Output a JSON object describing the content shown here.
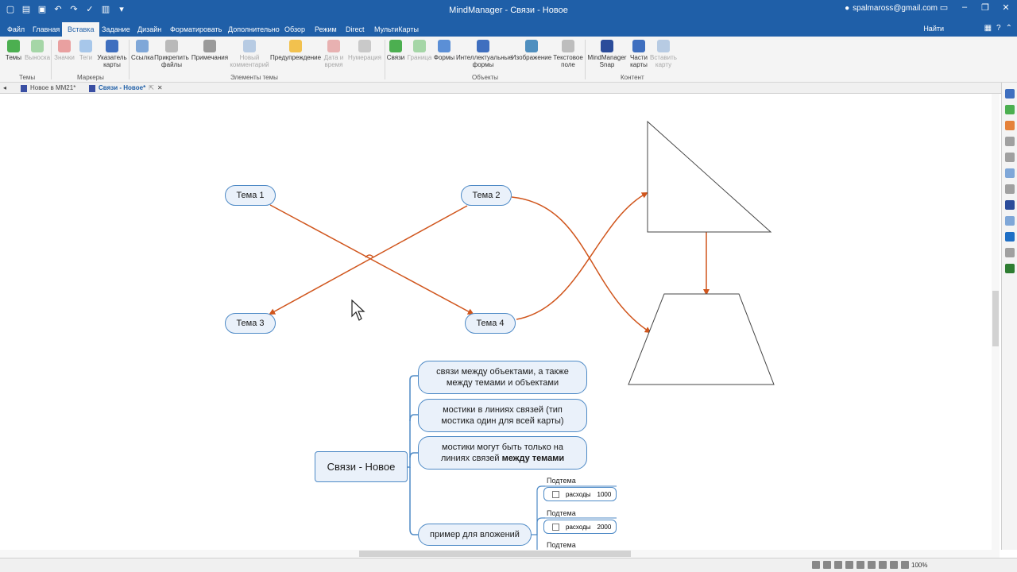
{
  "window": {
    "title": "MindManager - Связи - Новое",
    "account": "spalmaross@gmail.com"
  },
  "menu": {
    "tabs": [
      "Файл",
      "Главная",
      "Вставка",
      "Задание",
      "Дизайн",
      "Форматировать",
      "Дополнительно",
      "Обзор",
      "Режим",
      "Direct",
      "МультиКарты"
    ],
    "active": "Вставка",
    "search": "Найти"
  },
  "ribbon": {
    "buttons": {
      "topics": "Темы",
      "callout": "Выноска",
      "icons": "Значки",
      "tags": "Теги",
      "map_index": "Указатель карты",
      "link": "Ссылка",
      "attach": "Прикрепить файлы",
      "notes": "Примечания",
      "new_comment": "Новый комментарий",
      "alert": "Предупреждение",
      "date_time": "Дата и время",
      "numbering": "Нумерация",
      "relations": "Связи",
      "boundary": "Граница",
      "shapes": "Формы",
      "smart_shapes": "Интеллектуальные формы",
      "image": "Изображение",
      "text_box": "Текстовое поле",
      "snap": "MindManager Snap",
      "map_parts": "Части карты",
      "insert_map": "Вставить карту"
    },
    "groups": {
      "topics": "Темы",
      "markers": "Маркеры",
      "topic_elements": "Элементы темы",
      "objects": "Объекты",
      "content": "Контент"
    }
  },
  "doc_tabs": [
    {
      "label": "Новое в MM21*",
      "active": false
    },
    {
      "label": "Связи - Новое*",
      "active": true
    }
  ],
  "map": {
    "topics": {
      "t1": "Тема 1",
      "t2": "Тема 2",
      "t3": "Тема 3",
      "t4": "Тема 4"
    },
    "central": "Связи - Новое",
    "branches": {
      "b1": "связи между объектами, а также между темами и объектами",
      "b2": "мостики в линиях связей (тип мостика один для всей карты)",
      "b3_prefix": "мостики могут быть только на линиях связей",
      "b3_bold": "между темами",
      "b4": "пример для вложений"
    },
    "subtopics": [
      {
        "label": "Подтема",
        "row_label": "расходы",
        "row_value": "1000"
      },
      {
        "label": "Подтема",
        "row_label": "расходы",
        "row_value": "2000"
      },
      {
        "label": "Подтема"
      }
    ]
  },
  "status": {
    "zoom": "100%"
  },
  "colors": {
    "titlebar": "#1f5fa8",
    "relation": "#d0551c",
    "topic_border": "#4e8ac6",
    "topic_fill": "#eaf1fa"
  }
}
